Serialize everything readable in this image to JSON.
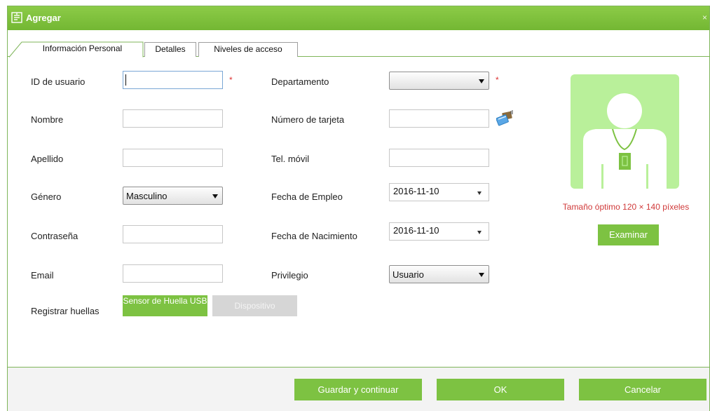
{
  "window": {
    "title": "Agregar",
    "close": "×"
  },
  "tabs": [
    {
      "label": "Información Personal",
      "active": true
    },
    {
      "label": "Detalles",
      "active": false
    },
    {
      "label": "Niveles de acceso",
      "active": false
    }
  ],
  "form": {
    "user_id": {
      "label": "ID de usuario",
      "value": "",
      "required": "*"
    },
    "first_name": {
      "label": "Nombre",
      "value": ""
    },
    "last_name": {
      "label": "Apellido",
      "value": ""
    },
    "gender": {
      "label": "Género",
      "value": "Masculino"
    },
    "password": {
      "label": "Contraseña",
      "value": ""
    },
    "email": {
      "label": "Email",
      "value": ""
    },
    "department": {
      "label": "Departamento",
      "value": "",
      "required": "*"
    },
    "card_number": {
      "label": "Número de tarjeta",
      "value": ""
    },
    "mobile": {
      "label": "Tel. móvil",
      "value": ""
    },
    "hire_date": {
      "label": "Fecha de Empleo",
      "value": "2016-11-10"
    },
    "birth_date": {
      "label": "Fecha de Nacimiento",
      "value": "2016-11-10"
    },
    "privilege": {
      "label": "Privilegio",
      "value": "Usuario"
    }
  },
  "fingerprints": {
    "label": "Registrar huellas",
    "usb_button": "Sensor de Huella USB",
    "device_button": "Dispositivo"
  },
  "photo": {
    "size_hint": "Tamaño óptimo 120 × 140 píxeles",
    "browse_button": "Examinar"
  },
  "footer": {
    "save_continue": "Guardar y continuar",
    "ok": "OK",
    "cancel": "Cancelar"
  },
  "colors": {
    "accent_green": "#7dc242",
    "title_green": "#73b733",
    "photo_bg": "#b9f09a",
    "required_red": "#d33333",
    "hint_red": "#d03a3a"
  },
  "icons": {
    "title": "add-user-form-icon",
    "card": "card-reader-icon",
    "avatar": "person-avatar-placeholder"
  }
}
